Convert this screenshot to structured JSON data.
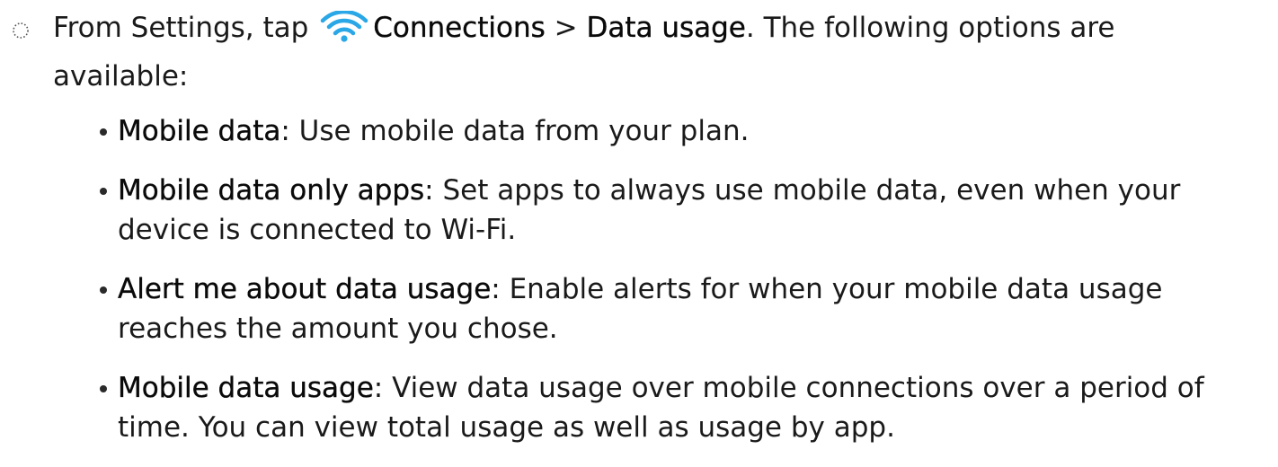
{
  "step": {
    "intro_prefix": "From Settings, tap",
    "connections_label": "Connections",
    "separator": " > ",
    "data_usage_label": "Data usage",
    "intro_suffix": ". The following options are available:",
    "wifi_icon_color": "#2aa7e6"
  },
  "options": [
    {
      "term": "Mobile data",
      "description": ": Use mobile data from your plan."
    },
    {
      "term": "Mobile data only apps",
      "description": ": Set apps to always use mobile data, even when your device is connected to Wi-Fi."
    },
    {
      "term": "Alert me about data usage",
      "description": ": Enable alerts for when your mobile data usage reaches the amount you chose."
    },
    {
      "term": "Mobile data usage",
      "description": ": View data usage over mobile connections over a period of time. You can view total usage as well as usage by app."
    }
  ]
}
